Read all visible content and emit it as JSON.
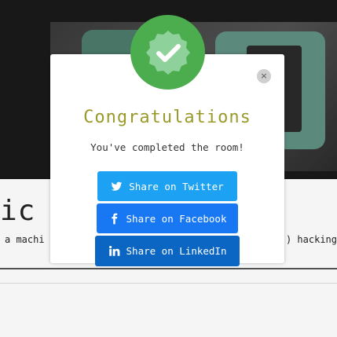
{
  "background": {
    "title": "ic",
    "subtitle_left": "a machi",
    "subtitle_right": ") hacking"
  },
  "modal": {
    "title": "Congratulations",
    "message": "You've completed the room!",
    "close_glyph": "×",
    "badge_icon": "check-badge-icon",
    "share_buttons": [
      {
        "label": "Share on Twitter",
        "icon": "twitter-icon",
        "color": "#1da1f2"
      },
      {
        "label": "Share on Facebook",
        "icon": "facebook-icon",
        "color": "#1877f2"
      },
      {
        "label": "Share on LinkedIn",
        "icon": "linkedin-icon",
        "color": "#0a66c2"
      }
    ]
  },
  "colors": {
    "badge": "#4cad4f",
    "title": "#9a9a2a"
  }
}
